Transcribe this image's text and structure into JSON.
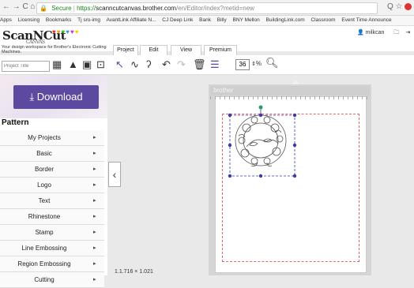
{
  "browser": {
    "nav_glyphs": "←  →  C  ⌂",
    "secure_label": "Secure",
    "url_scheme": "https://",
    "url_domain": "scanncutcanvas.brother.com",
    "url_path": "/en/Editor/index?metid=new",
    "actions": "Q ☆"
  },
  "bookmarks": [
    "Apps",
    "Licensing",
    "Bookmarks",
    "Tj sro-img",
    "AvantLink Affiliate N...",
    "CJ Deep Link",
    "Bank",
    "Billy",
    "BNY Mellon",
    "BuildingLink.com",
    "Classroom",
    "Event Time Announce"
  ],
  "header": {
    "logo": "ScanNCut",
    "logo_sub": "CANVAS",
    "tagline": "Your design workspace for Brother's Electronic Cutting Machines.",
    "user": "milkcan"
  },
  "menus": [
    "Project",
    "Edit",
    "View",
    "Premium"
  ],
  "toolbar": {
    "project_title_placeholder": "Project Title",
    "zoom_value": "36",
    "zoom_unit": "%"
  },
  "sidebar": {
    "download_label": "Download",
    "pattern_heading": "Pattern",
    "items": [
      "My Projects",
      "Basic",
      "Border",
      "Logo",
      "Text",
      "Rhinestone",
      "Stamp",
      "Line Embossing",
      "Region Embossing",
      "Cutting"
    ]
  },
  "canvas": {
    "mat_brand": "brother",
    "coord_readout": "1.1.716 × 1.021"
  },
  "colors": {
    "accent": "#5d4aa0",
    "selection": "#3a3aa8",
    "cut_line": "#e06a6a",
    "secure": "#1a8a1a"
  }
}
